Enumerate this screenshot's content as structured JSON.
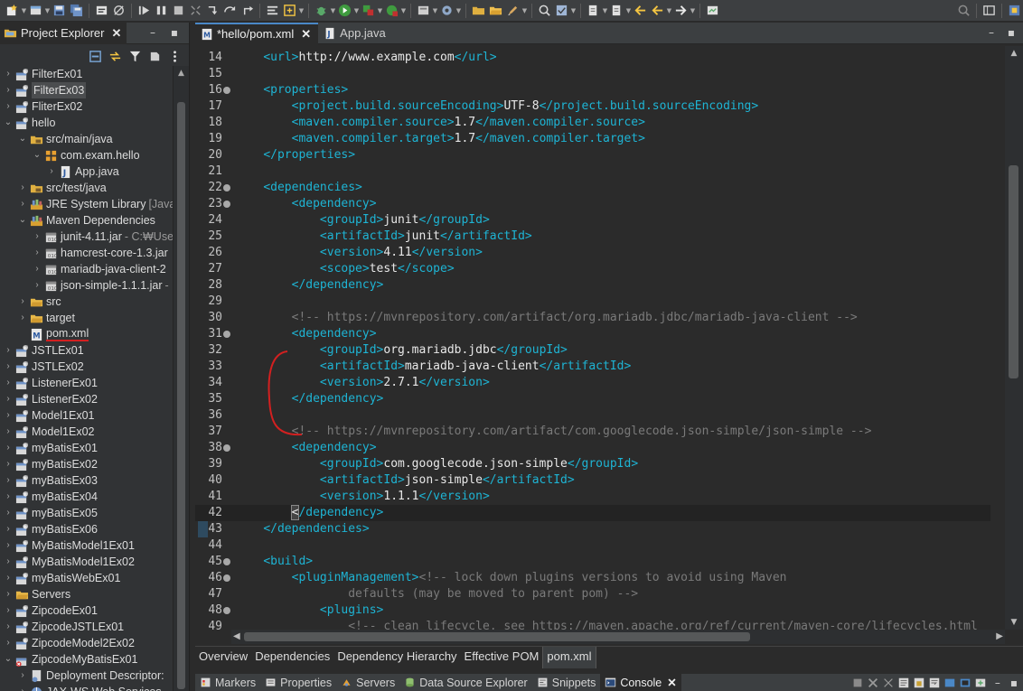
{
  "project_explorer": {
    "title": "Project Explorer",
    "items": [
      {
        "label": "FilterEx01",
        "indent": 0,
        "chevron": "›",
        "icon": "project-icon",
        "deco": ""
      },
      {
        "label": "FilterEx03",
        "indent": 0,
        "chevron": "›",
        "icon": "project-icon",
        "deco": "",
        "highlight": true
      },
      {
        "label": "FliterEx02",
        "indent": 0,
        "chevron": "›",
        "icon": "project-icon",
        "deco": ""
      },
      {
        "label": "hello",
        "indent": 0,
        "chevron": "⌄",
        "icon": "project-icon",
        "deco": ""
      },
      {
        "label": "src/main/java",
        "indent": 1,
        "chevron": "⌄",
        "icon": "source-folder-icon",
        "deco": ""
      },
      {
        "label": "com.exam.hello",
        "indent": 2,
        "chevron": "⌄",
        "icon": "package-icon",
        "deco": ""
      },
      {
        "label": "App.java",
        "indent": 3,
        "chevron": "›",
        "icon": "java-file-icon",
        "deco": ""
      },
      {
        "label": "src/test/java",
        "indent": 1,
        "chevron": "›",
        "icon": "source-folder-icon",
        "deco": ""
      },
      {
        "label": "JRE System Library",
        "indent": 1,
        "chevron": "›",
        "icon": "library-icon",
        "deco": "[JavaS"
      },
      {
        "label": "Maven Dependencies",
        "indent": 1,
        "chevron": "⌄",
        "icon": "library-icon",
        "deco": ""
      },
      {
        "label": "junit-4.11.jar",
        "indent": 2,
        "chevron": "›",
        "icon": "jar-icon",
        "deco": "- C:₩Use"
      },
      {
        "label": "hamcrest-core-1.3.jar",
        "indent": 2,
        "chevron": "›",
        "icon": "jar-icon",
        "deco": ""
      },
      {
        "label": "mariadb-java-client-2",
        "indent": 2,
        "chevron": "›",
        "icon": "jar-icon",
        "deco": ""
      },
      {
        "label": "json-simple-1.1.1.jar",
        "indent": 2,
        "chevron": "›",
        "icon": "jar-icon",
        "deco": "-"
      },
      {
        "label": "src",
        "indent": 1,
        "chevron": "›",
        "icon": "folder-icon",
        "deco": ""
      },
      {
        "label": "target",
        "indent": 1,
        "chevron": "›",
        "icon": "folder-icon",
        "deco": ""
      },
      {
        "label": "pom.xml",
        "indent": 1,
        "chevron": "",
        "icon": "maven-file-icon",
        "deco": "",
        "underline": true
      },
      {
        "label": "JSTLEx01",
        "indent": 0,
        "chevron": "›",
        "icon": "project-icon",
        "deco": ""
      },
      {
        "label": "JSTLEx02",
        "indent": 0,
        "chevron": "›",
        "icon": "project-icon",
        "deco": ""
      },
      {
        "label": "ListenerEx01",
        "indent": 0,
        "chevron": "›",
        "icon": "project-icon",
        "deco": ""
      },
      {
        "label": "ListenerEx02",
        "indent": 0,
        "chevron": "›",
        "icon": "project-icon",
        "deco": ""
      },
      {
        "label": "Model1Ex01",
        "indent": 0,
        "chevron": "›",
        "icon": "project-icon",
        "deco": ""
      },
      {
        "label": "Model1Ex02",
        "indent": 0,
        "chevron": "›",
        "icon": "project-icon",
        "deco": ""
      },
      {
        "label": "myBatisEx01",
        "indent": 0,
        "chevron": "›",
        "icon": "project-icon",
        "deco": ""
      },
      {
        "label": "myBatisEx02",
        "indent": 0,
        "chevron": "›",
        "icon": "project-icon",
        "deco": ""
      },
      {
        "label": "myBatisEx03",
        "indent": 0,
        "chevron": "›",
        "icon": "project-icon",
        "deco": ""
      },
      {
        "label": "myBatisEx04",
        "indent": 0,
        "chevron": "›",
        "icon": "project-icon",
        "deco": ""
      },
      {
        "label": "myBatisEx05",
        "indent": 0,
        "chevron": "›",
        "icon": "project-icon",
        "deco": ""
      },
      {
        "label": "myBatisEx06",
        "indent": 0,
        "chevron": "›",
        "icon": "project-icon",
        "deco": ""
      },
      {
        "label": "MyBatisModel1Ex01",
        "indent": 0,
        "chevron": "›",
        "icon": "project-icon",
        "deco": ""
      },
      {
        "label": "MyBatisModel1Ex02",
        "indent": 0,
        "chevron": "›",
        "icon": "project-icon",
        "deco": ""
      },
      {
        "label": "myBatisWebEx01",
        "indent": 0,
        "chevron": "›",
        "icon": "project-icon",
        "deco": ""
      },
      {
        "label": "Servers",
        "indent": 0,
        "chevron": "›",
        "icon": "folder-icon",
        "deco": ""
      },
      {
        "label": "ZipcodeEx01",
        "indent": 0,
        "chevron": "›",
        "icon": "project-icon",
        "deco": ""
      },
      {
        "label": "ZipcodeJSTLEx01",
        "indent": 0,
        "chevron": "›",
        "icon": "project-icon",
        "deco": ""
      },
      {
        "label": "ZipcodeModel2Ex02",
        "indent": 0,
        "chevron": "›",
        "icon": "project-icon",
        "deco": ""
      },
      {
        "label": "ZipcodeMyBatisEx01",
        "indent": 0,
        "chevron": "⌄",
        "icon": "project-error-icon",
        "deco": ""
      },
      {
        "label": "Deployment Descriptor:",
        "indent": 1,
        "chevron": "›",
        "icon": "descriptor-icon",
        "deco": ""
      },
      {
        "label": "JAX-WS Web Services",
        "indent": 1,
        "chevron": "›",
        "icon": "webservice-icon",
        "deco": ""
      }
    ]
  },
  "editor": {
    "tabs": [
      {
        "label": "*hello/pom.xml",
        "active": true,
        "icon": "maven-file-icon",
        "closable": true
      },
      {
        "label": "App.java",
        "active": false,
        "icon": "java-file-icon",
        "closable": false
      }
    ],
    "close_glyph": "✕",
    "lines": [
      {
        "n": "14",
        "fold": false,
        "segs": [
          [
            "i",
            "    "
          ],
          [
            "t",
            "<url>"
          ],
          [
            "x",
            "http://www.example.com"
          ],
          [
            "t",
            "</url>"
          ]
        ]
      },
      {
        "n": "15",
        "fold": false,
        "segs": []
      },
      {
        "n": "16",
        "fold": true,
        "segs": [
          [
            "i",
            "    "
          ],
          [
            "t",
            "<properties>"
          ]
        ]
      },
      {
        "n": "17",
        "fold": false,
        "segs": [
          [
            "i",
            "        "
          ],
          [
            "t",
            "<project.build.sourceEncoding>"
          ],
          [
            "x",
            "UTF-8"
          ],
          [
            "t",
            "</project.build.sourceEncoding>"
          ]
        ]
      },
      {
        "n": "18",
        "fold": false,
        "segs": [
          [
            "i",
            "        "
          ],
          [
            "t",
            "<maven.compiler.source>"
          ],
          [
            "x",
            "1.7"
          ],
          [
            "t",
            "</maven.compiler.source>"
          ]
        ]
      },
      {
        "n": "19",
        "fold": false,
        "segs": [
          [
            "i",
            "        "
          ],
          [
            "t",
            "<maven.compiler.target>"
          ],
          [
            "x",
            "1.7"
          ],
          [
            "t",
            "</maven.compiler.target>"
          ]
        ]
      },
      {
        "n": "20",
        "fold": false,
        "segs": [
          [
            "i",
            "    "
          ],
          [
            "t",
            "</properties>"
          ]
        ]
      },
      {
        "n": "21",
        "fold": false,
        "segs": []
      },
      {
        "n": "22",
        "fold": true,
        "segs": [
          [
            "i",
            "    "
          ],
          [
            "t",
            "<dependencies>"
          ]
        ]
      },
      {
        "n": "23",
        "fold": true,
        "segs": [
          [
            "i",
            "        "
          ],
          [
            "t",
            "<dependency>"
          ]
        ]
      },
      {
        "n": "24",
        "fold": false,
        "segs": [
          [
            "i",
            "            "
          ],
          [
            "t",
            "<groupId>"
          ],
          [
            "x",
            "junit"
          ],
          [
            "t",
            "</groupId>"
          ]
        ]
      },
      {
        "n": "25",
        "fold": false,
        "segs": [
          [
            "i",
            "            "
          ],
          [
            "t",
            "<artifactId>"
          ],
          [
            "x",
            "junit"
          ],
          [
            "t",
            "</artifactId>"
          ]
        ]
      },
      {
        "n": "26",
        "fold": false,
        "segs": [
          [
            "i",
            "            "
          ],
          [
            "t",
            "<version>"
          ],
          [
            "x",
            "4.11"
          ],
          [
            "t",
            "</version>"
          ]
        ]
      },
      {
        "n": "27",
        "fold": false,
        "segs": [
          [
            "i",
            "            "
          ],
          [
            "t",
            "<scope>"
          ],
          [
            "x",
            "test"
          ],
          [
            "t",
            "</scope>"
          ]
        ]
      },
      {
        "n": "28",
        "fold": false,
        "segs": [
          [
            "i",
            "        "
          ],
          [
            "t",
            "</dependency>"
          ]
        ]
      },
      {
        "n": "29",
        "fold": false,
        "segs": []
      },
      {
        "n": "30",
        "fold": false,
        "segs": [
          [
            "i",
            "        "
          ],
          [
            "c",
            "<!-- https://mvnrepository.com/artifact/org.mariadb.jdbc/mariadb-java-client -->"
          ]
        ]
      },
      {
        "n": "31",
        "fold": true,
        "segs": [
          [
            "i",
            "        "
          ],
          [
            "t",
            "<dependency>"
          ]
        ]
      },
      {
        "n": "32",
        "fold": false,
        "segs": [
          [
            "i",
            "            "
          ],
          [
            "t",
            "<groupId>"
          ],
          [
            "x",
            "org.mariadb.jdbc"
          ],
          [
            "t",
            "</groupId>"
          ]
        ]
      },
      {
        "n": "33",
        "fold": false,
        "segs": [
          [
            "i",
            "            "
          ],
          [
            "t",
            "<artifactId>"
          ],
          [
            "x",
            "mariadb-java-client"
          ],
          [
            "t",
            "</artifactId>"
          ]
        ]
      },
      {
        "n": "34",
        "fold": false,
        "segs": [
          [
            "i",
            "            "
          ],
          [
            "t",
            "<version>"
          ],
          [
            "x",
            "2.7.1"
          ],
          [
            "t",
            "</version>"
          ]
        ]
      },
      {
        "n": "35",
        "fold": false,
        "segs": [
          [
            "i",
            "        "
          ],
          [
            "t",
            "</dependency>"
          ]
        ]
      },
      {
        "n": "36",
        "fold": false,
        "segs": []
      },
      {
        "n": "37",
        "fold": false,
        "segs": [
          [
            "i",
            "        "
          ],
          [
            "c",
            "<!-- https://mvnrepository.com/artifact/com.googlecode.json-simple/json-simple -->"
          ]
        ]
      },
      {
        "n": "38",
        "fold": true,
        "segs": [
          [
            "i",
            "        "
          ],
          [
            "t",
            "<dependency>"
          ]
        ]
      },
      {
        "n": "39",
        "fold": false,
        "segs": [
          [
            "i",
            "            "
          ],
          [
            "t",
            "<groupId>"
          ],
          [
            "x",
            "com.googlecode.json-simple"
          ],
          [
            "t",
            "</groupId>"
          ]
        ]
      },
      {
        "n": "40",
        "fold": false,
        "segs": [
          [
            "i",
            "            "
          ],
          [
            "t",
            "<artifactId>"
          ],
          [
            "x",
            "json-simple"
          ],
          [
            "t",
            "</artifactId>"
          ]
        ]
      },
      {
        "n": "41",
        "fold": false,
        "segs": [
          [
            "i",
            "            "
          ],
          [
            "t",
            "<version>"
          ],
          [
            "x",
            "1.1.1"
          ],
          [
            "t",
            "</version>"
          ]
        ]
      },
      {
        "n": "42",
        "fold": false,
        "current": true,
        "segs": [
          [
            "i",
            "        "
          ],
          [
            "b",
            "<"
          ],
          [
            "t",
            "/dependency>"
          ]
        ]
      },
      {
        "n": "43",
        "fold": false,
        "segs": [
          [
            "i",
            "    "
          ],
          [
            "t",
            "</dependencies>"
          ]
        ]
      },
      {
        "n": "44",
        "fold": false,
        "segs": []
      },
      {
        "n": "45",
        "fold": true,
        "segs": [
          [
            "i",
            "    "
          ],
          [
            "t",
            "<build>"
          ]
        ]
      },
      {
        "n": "46",
        "fold": true,
        "segs": [
          [
            "i",
            "        "
          ],
          [
            "t",
            "<pluginManagement>"
          ],
          [
            "c",
            "<!-- lock down plugins versions to avoid using Maven"
          ]
        ]
      },
      {
        "n": "47",
        "fold": false,
        "segs": [
          [
            "i",
            "                "
          ],
          [
            "c",
            "defaults (may be moved to parent pom) -->"
          ]
        ]
      },
      {
        "n": "48",
        "fold": true,
        "segs": [
          [
            "i",
            "            "
          ],
          [
            "t",
            "<plugins>"
          ]
        ]
      },
      {
        "n": "49",
        "fold": false,
        "segs": [
          [
            "i",
            "                "
          ],
          [
            "c",
            "<!-- clean lifecycle, see https://maven.apache.org/ref/current/maven-core/lifecycles.html"
          ]
        ]
      }
    ],
    "bottom_tabs": [
      {
        "label": "Overview",
        "active": false
      },
      {
        "label": "Dependencies",
        "active": false
      },
      {
        "label": "Dependency Hierarchy",
        "active": false
      },
      {
        "label": "Effective POM",
        "active": false
      },
      {
        "label": "pom.xml",
        "active": true
      }
    ]
  },
  "bottom_views": {
    "tabs": [
      {
        "label": "Markers",
        "icon": "markers-icon",
        "active": false
      },
      {
        "label": "Properties",
        "icon": "properties-icon",
        "active": false
      },
      {
        "label": "Servers",
        "icon": "servers-icon",
        "active": false
      },
      {
        "label": "Data Source Explorer",
        "icon": "data-source-icon",
        "active": false
      },
      {
        "label": "Snippets",
        "icon": "snippets-icon",
        "active": false
      },
      {
        "label": "Console",
        "icon": "console-icon",
        "active": true
      }
    ]
  },
  "window_controls": {
    "minimize": "–",
    "maximize": "▪"
  },
  "colors": {
    "tag": "#1eb4d4",
    "text": "#e8e8e8",
    "comment": "#7a7a7a",
    "annotation": "#d32020"
  }
}
